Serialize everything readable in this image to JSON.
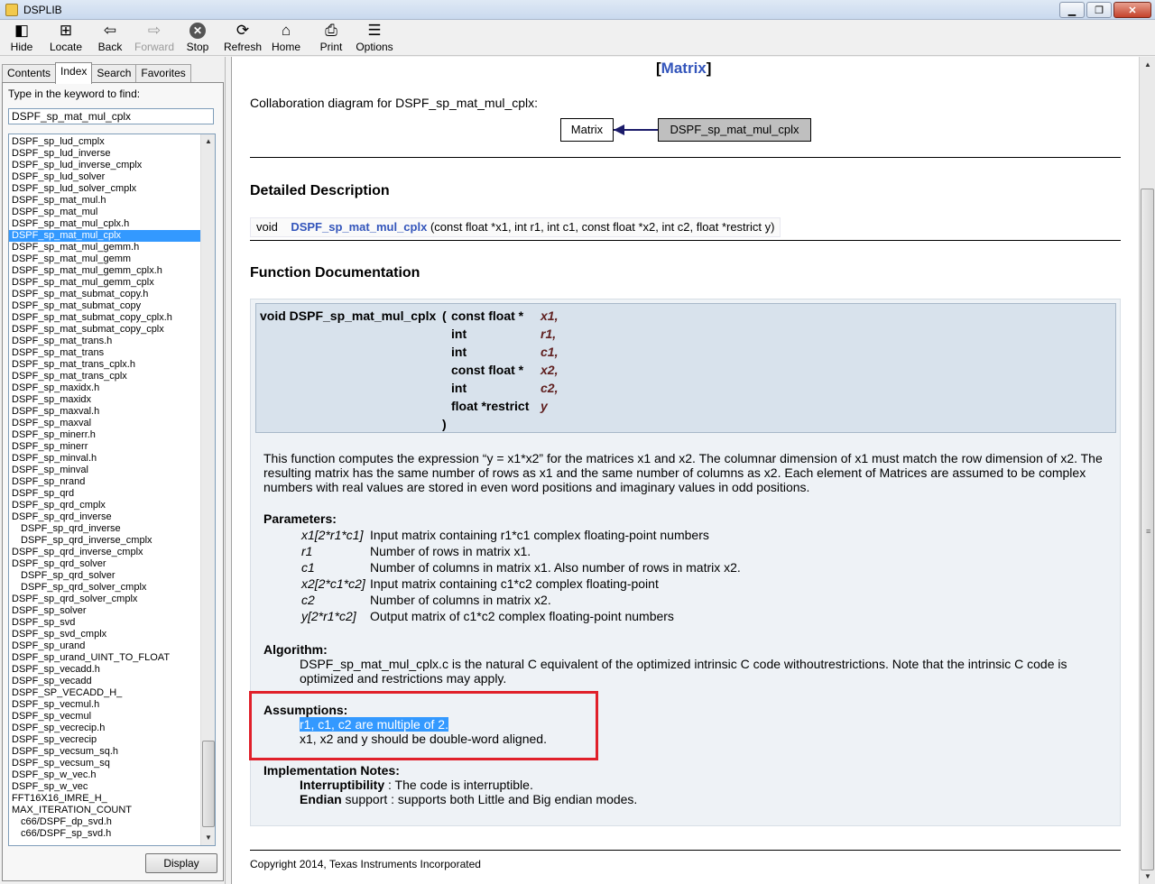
{
  "window": {
    "title": "DSPLIB",
    "controls": {
      "minimize": "▁",
      "maximize": "❐",
      "close": "✕"
    }
  },
  "toolbar": {
    "items": [
      {
        "name": "hide",
        "label": "Hide",
        "icon": "hide-icon",
        "glyph": "◧",
        "enabled": true
      },
      {
        "name": "locate",
        "label": "Locate",
        "icon": "locate-icon",
        "glyph": "⊞",
        "enabled": true
      },
      {
        "name": "back",
        "label": "Back",
        "icon": "back-arrow-icon",
        "glyph": "⇦",
        "enabled": true
      },
      {
        "name": "forward",
        "label": "Forward",
        "icon": "forward-arrow-icon",
        "glyph": "⇨",
        "enabled": false
      },
      {
        "name": "stop",
        "label": "Stop",
        "icon": "stop-icon",
        "glyph": "✕",
        "enabled": true
      },
      {
        "name": "refresh",
        "label": "Refresh",
        "icon": "refresh-icon",
        "glyph": "⟳",
        "enabled": true
      },
      {
        "name": "home",
        "label": "Home",
        "icon": "home-icon",
        "glyph": "⌂",
        "enabled": true
      },
      {
        "name": "print",
        "label": "Print",
        "icon": "print-icon",
        "glyph": "⎙",
        "enabled": true
      },
      {
        "name": "options",
        "label": "Options",
        "icon": "options-icon",
        "glyph": "☰",
        "enabled": true
      }
    ]
  },
  "navpane": {
    "tabs": [
      {
        "label": "Contents",
        "active": false
      },
      {
        "label": "Index",
        "active": true
      },
      {
        "label": "Search",
        "active": false
      },
      {
        "label": "Favorites",
        "active": false
      }
    ],
    "keyword_label": "Type in the keyword to find:",
    "keyword_value": "DSPF_sp_mat_mul_cplx",
    "display_button": "Display",
    "selected_index": 8,
    "index_items": [
      {
        "text": "DSPF_sp_lud_cmplx",
        "sub": false
      },
      {
        "text": "DSPF_sp_lud_inverse",
        "sub": false
      },
      {
        "text": "DSPF_sp_lud_inverse_cmplx",
        "sub": false
      },
      {
        "text": "DSPF_sp_lud_solver",
        "sub": false
      },
      {
        "text": "DSPF_sp_lud_solver_cmplx",
        "sub": false
      },
      {
        "text": "DSPF_sp_mat_mul.h",
        "sub": false
      },
      {
        "text": "DSPF_sp_mat_mul",
        "sub": false
      },
      {
        "text": "DSPF_sp_mat_mul_cplx.h",
        "sub": false
      },
      {
        "text": "DSPF_sp_mat_mul_cplx",
        "sub": false
      },
      {
        "text": "DSPF_sp_mat_mul_gemm.h",
        "sub": false
      },
      {
        "text": "DSPF_sp_mat_mul_gemm",
        "sub": false
      },
      {
        "text": "DSPF_sp_mat_mul_gemm_cplx.h",
        "sub": false
      },
      {
        "text": "DSPF_sp_mat_mul_gemm_cplx",
        "sub": false
      },
      {
        "text": "DSPF_sp_mat_submat_copy.h",
        "sub": false
      },
      {
        "text": "DSPF_sp_mat_submat_copy",
        "sub": false
      },
      {
        "text": "DSPF_sp_mat_submat_copy_cplx.h",
        "sub": false
      },
      {
        "text": "DSPF_sp_mat_submat_copy_cplx",
        "sub": false
      },
      {
        "text": "DSPF_sp_mat_trans.h",
        "sub": false
      },
      {
        "text": "DSPF_sp_mat_trans",
        "sub": false
      },
      {
        "text": "DSPF_sp_mat_trans_cplx.h",
        "sub": false
      },
      {
        "text": "DSPF_sp_mat_trans_cplx",
        "sub": false
      },
      {
        "text": "DSPF_sp_maxidx.h",
        "sub": false
      },
      {
        "text": "DSPF_sp_maxidx",
        "sub": false
      },
      {
        "text": "DSPF_sp_maxval.h",
        "sub": false
      },
      {
        "text": "DSPF_sp_maxval",
        "sub": false
      },
      {
        "text": "DSPF_sp_minerr.h",
        "sub": false
      },
      {
        "text": "DSPF_sp_minerr",
        "sub": false
      },
      {
        "text": "DSPF_sp_minval.h",
        "sub": false
      },
      {
        "text": "DSPF_sp_minval",
        "sub": false
      },
      {
        "text": "DSPF_sp_nrand",
        "sub": false
      },
      {
        "text": "DSPF_sp_qrd",
        "sub": false
      },
      {
        "text": "DSPF_sp_qrd_cmplx",
        "sub": false
      },
      {
        "text": "DSPF_sp_qrd_inverse",
        "sub": false
      },
      {
        "text": "DSPF_sp_qrd_inverse",
        "sub": true
      },
      {
        "text": "DSPF_sp_qrd_inverse_cmplx",
        "sub": true
      },
      {
        "text": "DSPF_sp_qrd_inverse_cmplx",
        "sub": false
      },
      {
        "text": "DSPF_sp_qrd_solver",
        "sub": false
      },
      {
        "text": "DSPF_sp_qrd_solver",
        "sub": true
      },
      {
        "text": "DSPF_sp_qrd_solver_cmplx",
        "sub": true
      },
      {
        "text": "DSPF_sp_qrd_solver_cmplx",
        "sub": false
      },
      {
        "text": "DSPF_sp_solver",
        "sub": false
      },
      {
        "text": "DSPF_sp_svd",
        "sub": false
      },
      {
        "text": "DSPF_sp_svd_cmplx",
        "sub": false
      },
      {
        "text": "DSPF_sp_urand",
        "sub": false
      },
      {
        "text": "DSPF_sp_urand_UINT_TO_FLOAT",
        "sub": false
      },
      {
        "text": "DSPF_sp_vecadd.h",
        "sub": false
      },
      {
        "text": "DSPF_sp_vecadd",
        "sub": false
      },
      {
        "text": "DSPF_SP_VECADD_H_",
        "sub": false
      },
      {
        "text": "DSPF_sp_vecmul.h",
        "sub": false
      },
      {
        "text": "DSPF_sp_vecmul",
        "sub": false
      },
      {
        "text": "DSPF_sp_vecrecip.h",
        "sub": false
      },
      {
        "text": "DSPF_sp_vecrecip",
        "sub": false
      },
      {
        "text": "DSPF_sp_vecsum_sq.h",
        "sub": false
      },
      {
        "text": "DSPF_sp_vecsum_sq",
        "sub": false
      },
      {
        "text": "DSPF_sp_w_vec.h",
        "sub": false
      },
      {
        "text": "DSPF_sp_w_vec",
        "sub": false
      },
      {
        "text": "FFT16X16_IMRE_H_",
        "sub": false
      },
      {
        "text": "MAX_ITERATION_COUNT",
        "sub": false
      },
      {
        "text": "c66/DSPF_dp_svd.h",
        "sub": true
      },
      {
        "text": "c66/DSPF_sp_svd.h",
        "sub": true
      }
    ]
  },
  "doc": {
    "top_link_open": "[",
    "top_link": "Matrix",
    "top_link_close": "]",
    "collab_caption": "Collaboration diagram for DSPF_sp_mat_mul_cplx:",
    "collab_node_target": "Matrix",
    "collab_node_source": "DSPF_sp_mat_mul_cplx",
    "detailed_heading": "Detailed Description",
    "decl_type": "void",
    "decl_name": "DSPF_sp_mat_mul_cplx",
    "decl_args": "(const float *x1, int r1, int c1, const float *x2, int c2, float *restrict y)",
    "funcdoc_heading": "Function Documentation",
    "proto_lead": "void DSPF_sp_mat_mul_cplx",
    "proto_open": "(",
    "proto_close": ")",
    "proto_params": [
      {
        "type": "const float *",
        "name": "x1,"
      },
      {
        "type": "int",
        "name": "r1,"
      },
      {
        "type": "int",
        "name": "c1,"
      },
      {
        "type": "const float *",
        "name": "x2,"
      },
      {
        "type": "int",
        "name": "c2,"
      },
      {
        "type": "float *restrict",
        "name": "y"
      }
    ],
    "description_lines": [
      "This function computes the expression “y = x1*x2” for the matrices x1 and x2. The columnar dimension of x1 must match the row dimension of x2. The",
      "resulting matrix has the same number of rows as x1 and the same number of columns as x2. Each element of Matrices are assumed to be complex",
      "numbers with real values are stored in even word positions and imaginary values in odd positions."
    ],
    "parameters_heading": "Parameters:",
    "parameters": [
      {
        "name": "x1[2*r1*c1]",
        "desc": "Input matrix containing r1*c1 complex floating-point numbers"
      },
      {
        "name": "r1",
        "desc": "Number of rows in matrix x1."
      },
      {
        "name": "c1",
        "desc": "Number of columns in matrix x1. Also number of rows in matrix x2."
      },
      {
        "name": "x2[2*c1*c2]",
        "desc": "Input matrix containing c1*c2 complex floating-point"
      },
      {
        "name": "c2",
        "desc": "Number of columns in matrix x2."
      },
      {
        "name": "y[2*r1*c2]",
        "desc": "Output matrix of c1*c2 complex floating-point numbers"
      }
    ],
    "algorithm_heading": "Algorithm:",
    "algorithm_lines": [
      "DSPF_sp_mat_mul_cplx.c is the natural C equivalent of the optimized intrinsic C code withoutrestrictions. Note that the intrinsic C code is",
      "optimized and restrictions may apply."
    ],
    "assumptions_heading": "Assumptions:",
    "assumption_1": "r1, c1, c2 are multiple of 2.",
    "assumption_2": "x1, x2 and y should be double-word aligned.",
    "impl_heading": "Implementation Notes:",
    "impl_1_term": "Interruptibility",
    "impl_1_text": " : The code is interruptible.",
    "impl_2_term": "Endian",
    "impl_2_text": " support : supports both Little and Big endian modes.",
    "copyright": "Copyright 2014, Texas Instruments Incorporated"
  },
  "colors": {
    "link": "#3355bb",
    "selection": "#3399ff",
    "annotation_box": "#e0202a",
    "param_name": "#602020",
    "memdoc_bg": "#eef2f6",
    "proto_bg": "#d8e2ec"
  }
}
